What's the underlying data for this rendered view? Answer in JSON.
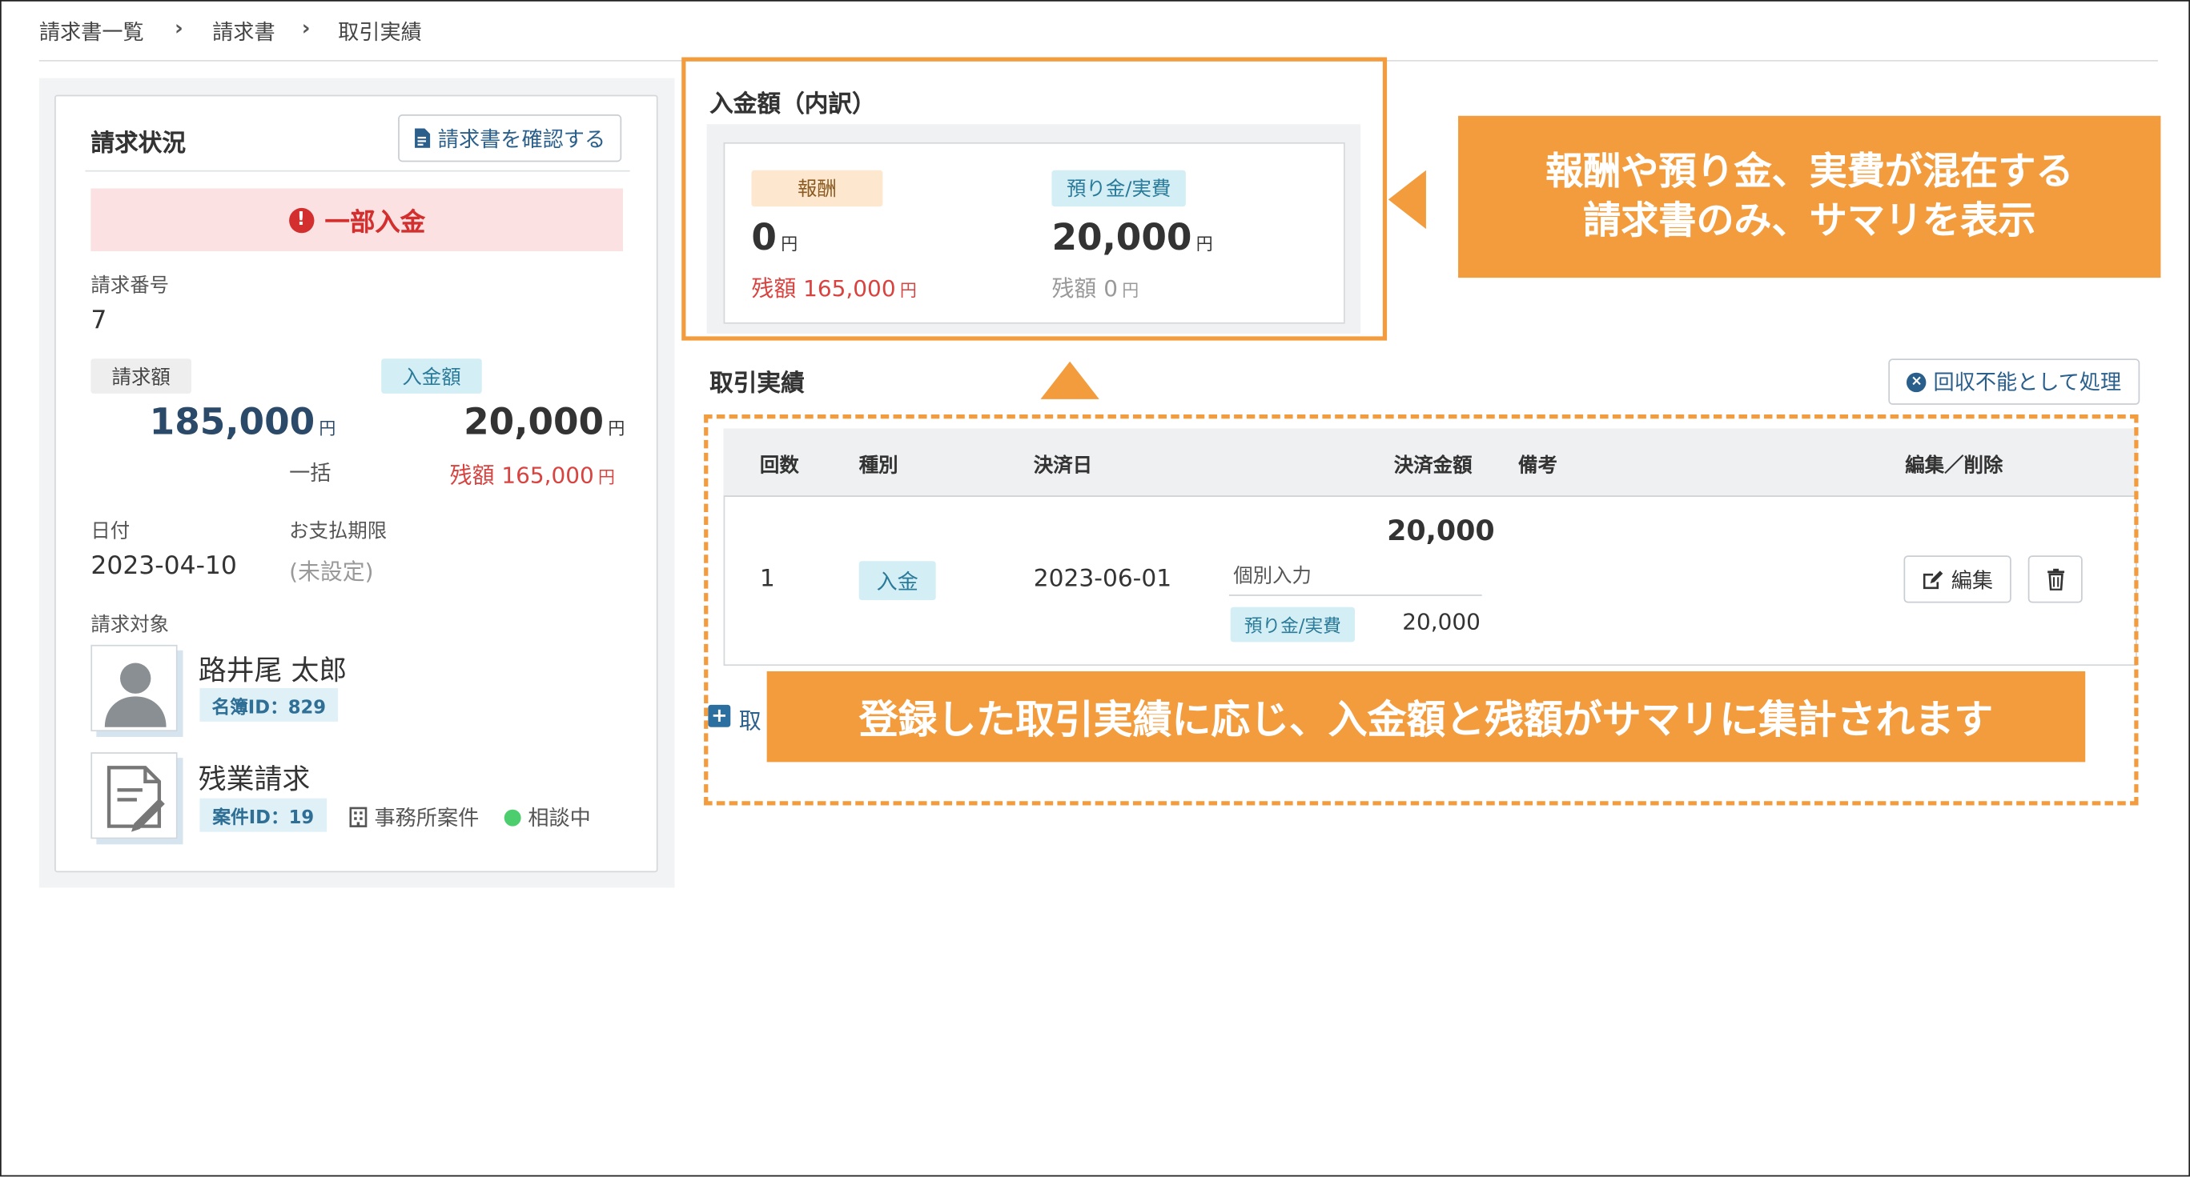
{
  "breadcrumb": {
    "item1": "請求書一覧",
    "item2": "請求書",
    "item3": "取引実績",
    "sep": "›"
  },
  "left": {
    "title": "請求状況",
    "confirm_btn": "請求書を確認する",
    "status": "一部入金",
    "status_icon": "!",
    "invoice_no_label": "請求番号",
    "invoice_no": "7",
    "billed_tag": "請求額",
    "paid_tag": "入金額",
    "billed_amount": "185,000",
    "paid_amount": "20,000",
    "yen": "円",
    "billed_sub": "一括",
    "remain_label": "残額",
    "remain_amount": "165,000",
    "date_label": "日付",
    "date": "2023-04-10",
    "due_label": "お支払期限",
    "due": "(未設定)",
    "target_label": "請求対象",
    "person_name": "路井尾 太郎",
    "person_id": "名簿ID：829",
    "case_name": "残業請求",
    "case_id": "案件ID：19",
    "case_office": "事務所案件",
    "case_status": "相談中"
  },
  "summary": {
    "title": "入金額（内訳）",
    "fee_tag": "報酬",
    "fee_amount": "0",
    "fee_remain_label": "残額",
    "fee_remain": "165,000",
    "deposit_tag": "預り金/実費",
    "deposit_amount": "20,000",
    "deposit_remain_label": "残額",
    "deposit_remain": "0",
    "yen": "円"
  },
  "callouts": {
    "summary_line1": "報酬や預り金、実費が混在する",
    "summary_line2": "請求書のみ、サマリを表示",
    "table_note": "登録した取引実績に応じ、入金額と残額がサマリに集計されます"
  },
  "transactions": {
    "title": "取引実績",
    "uncollectible_btn": "回収不能として処理",
    "headers": [
      "回数",
      "種別",
      "決済日",
      "決済金額",
      "備考",
      "編集／削除"
    ],
    "row": {
      "no": "1",
      "type": "入金",
      "date": "2023-06-01",
      "amount": "20,000",
      "sub_label": "個別入力",
      "sub_tag": "預り金/実費",
      "sub_amount": "20,000",
      "edit_label": "編集"
    },
    "add_label_partial": "取"
  },
  "colors": {
    "accent_orange": "#f39c3d",
    "alert_red": "#d32f2f",
    "navy": "#2b4a6a"
  }
}
